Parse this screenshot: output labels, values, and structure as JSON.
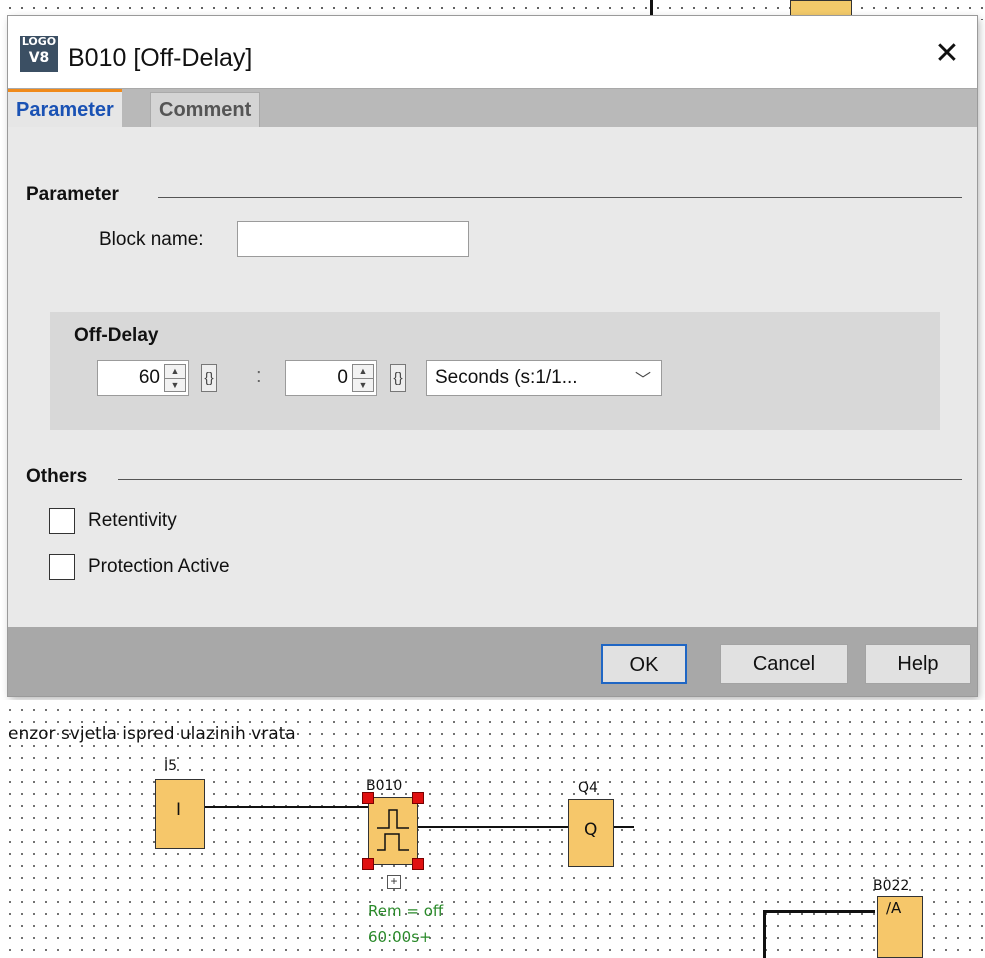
{
  "dialog": {
    "app_icon": {
      "line1": "LOGO",
      "line2": "V8"
    },
    "title": "B010 [Off-Delay]",
    "close_symbol": "✕",
    "tabs": [
      {
        "label": "Parameter",
        "active": true
      },
      {
        "label": "Comment",
        "active": false
      }
    ],
    "parameter_group": {
      "label": "Parameter",
      "block_name_label": "Block name:",
      "block_name_value": ""
    },
    "off_delay": {
      "label": "Off-Delay",
      "value1": "60",
      "value2": "0",
      "colon": ":",
      "param_symbol": "{}",
      "unit": "Seconds (s:1/1..."
    },
    "others_group": {
      "label": "Others",
      "checkboxes": [
        {
          "label": "Retentivity",
          "checked": false
        },
        {
          "label": "Protection Active",
          "checked": false
        }
      ]
    },
    "buttons": {
      "ok": "OK",
      "cancel": "Cancel",
      "help": "Help"
    }
  },
  "diagram": {
    "comment": "enzor svjetla ispred ulazinih vrata",
    "input_label": "I5",
    "input_letter": "I",
    "selected_block_label": "B010",
    "output_label": "Q4",
    "output_letter": "Q",
    "rem_text": "Rem = off",
    "time_text": "60:00s+",
    "other_block_label": "B022",
    "other_block_symbol": "∕A",
    "expand_symbol": "+"
  },
  "colors": {
    "tab_accent": "#f08a1a",
    "tab_active_text": "#1a52b4",
    "ok_border": "#1f66c4",
    "block_fill": "#f6c76a",
    "selection_handle": "#e01010",
    "diagram_note": "#2a8a2a"
  }
}
